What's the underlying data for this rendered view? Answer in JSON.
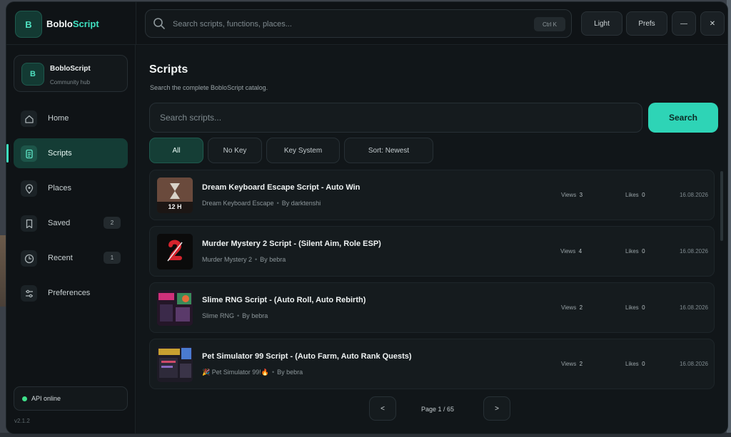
{
  "app": {
    "brand_initial": "B",
    "brand_name_prefix": "Boblo",
    "brand_name_accent": "Script",
    "accent_color": "#2ed4b6"
  },
  "topbar": {
    "search_placeholder": "Search scripts, functions, places...",
    "shortcut": "Ctrl K",
    "theme_label": "Light",
    "prefs_label": "Prefs",
    "minimize_label": "—",
    "close_label": "✕"
  },
  "sidebar": {
    "profile": {
      "initial": "B",
      "name": "BobloScript",
      "subtitle": "Community hub"
    },
    "items": [
      {
        "label": "Home",
        "icon": "home-icon"
      },
      {
        "label": "Scripts",
        "icon": "document-icon",
        "active": true
      },
      {
        "label": "Places",
        "icon": "map-pin-icon"
      },
      {
        "label": "Saved",
        "icon": "bookmark-icon",
        "count": "2"
      },
      {
        "label": "Recent",
        "icon": "clock-icon",
        "count": "1"
      },
      {
        "label": "Preferences",
        "icon": "sliders-icon"
      }
    ],
    "status": "API online",
    "version": "v2.1.2"
  },
  "main": {
    "title": "Scripts",
    "subtitle": "Search the complete BobloScript catalog.",
    "search_placeholder": "Search scripts...",
    "search_button": "Search",
    "filters": [
      "All",
      "No Key",
      "Key System",
      "Sort: Newest"
    ],
    "active_filter": "All",
    "views_label": "Views",
    "likes_label": "Likes",
    "by_prefix": "By",
    "scripts": [
      {
        "title": "Dream Keyboard Escape Script  - Auto Win",
        "place": "Dream Keyboard Escape",
        "author": "darktenshi",
        "views": "3",
        "likes": "0",
        "date": "16.08.2026",
        "thumb_text": "12 H"
      },
      {
        "title": "Murder Mystery 2 Script - (Silent Aim, Role ESP)",
        "place": "Murder Mystery 2",
        "author": "bebra",
        "views": "4",
        "likes": "0",
        "date": "16.08.2026",
        "thumb_text": ""
      },
      {
        "title": "Slime RNG Script - (Auto Roll, Auto Rebirth)",
        "place": "Slime RNG",
        "author": "bebra",
        "views": "2",
        "likes": "0",
        "date": "16.08.2026",
        "thumb_text": ""
      },
      {
        "title": "Pet Simulator 99 Script - (Auto Farm, Auto Rank Quests)",
        "place": "🎉 Pet Simulator 99!🔥",
        "author": "bebra",
        "views": "2",
        "likes": "0",
        "date": "16.08.2026",
        "thumb_text": ""
      }
    ],
    "pagination": {
      "prev": "<",
      "label": "Page 1 / 65",
      "next": ">"
    }
  }
}
